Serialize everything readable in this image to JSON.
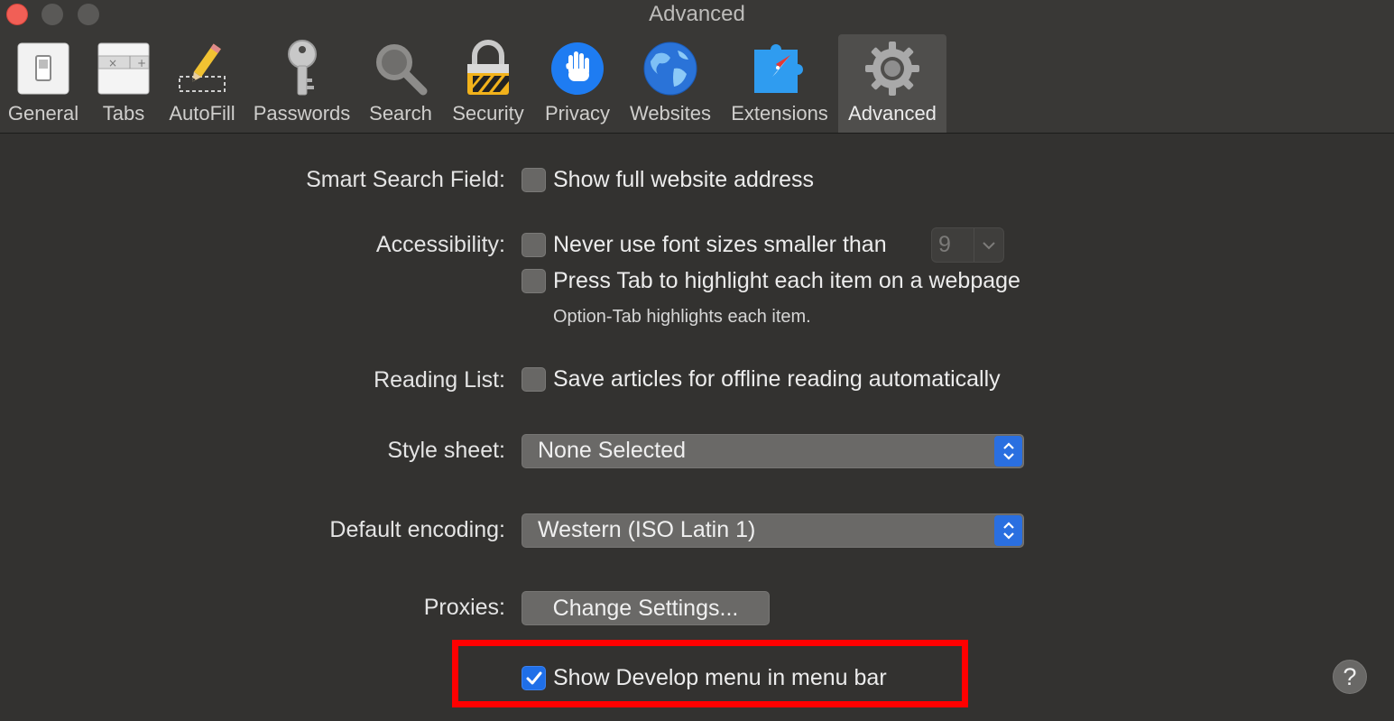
{
  "window": {
    "title": "Advanced"
  },
  "toolbar": {
    "items": [
      {
        "label": "General",
        "icon": "general-switch-icon"
      },
      {
        "label": "Tabs",
        "icon": "tabs-icon"
      },
      {
        "label": "AutoFill",
        "icon": "pencil-icon"
      },
      {
        "label": "Passwords",
        "icon": "key-icon"
      },
      {
        "label": "Search",
        "icon": "magnifier-icon"
      },
      {
        "label": "Security",
        "icon": "padlock-icon"
      },
      {
        "label": "Privacy",
        "icon": "hand-icon"
      },
      {
        "label": "Websites",
        "icon": "globe-icon"
      },
      {
        "label": "Extensions",
        "icon": "puzzle-compass-icon"
      },
      {
        "label": "Advanced",
        "icon": "gear-icon"
      }
    ],
    "selected": "Advanced"
  },
  "settings": {
    "smart_search": {
      "label": "Smart Search Field:",
      "option": "Show full website address",
      "checked": false
    },
    "accessibility": {
      "label": "Accessibility:",
      "font_size_option": "Never use font sizes smaller than",
      "font_size_value": "9",
      "tab_option": "Press Tab to highlight each item on a webpage",
      "tab_note": "Option-Tab highlights each item."
    },
    "reading_list": {
      "label": "Reading List:",
      "option": "Save articles for offline reading automatically",
      "checked": false
    },
    "style_sheet": {
      "label": "Style sheet:",
      "value": "None Selected"
    },
    "encoding": {
      "label": "Default encoding:",
      "value": "Western (ISO Latin 1)"
    },
    "proxies": {
      "label": "Proxies:",
      "button": "Change Settings..."
    },
    "develop": {
      "option": "Show Develop menu in menu bar",
      "checked": true
    }
  },
  "help": {
    "label": "?"
  },
  "colors": {
    "accent": "#1f6fe8",
    "highlight": "#ff0000",
    "background": "#333230"
  }
}
